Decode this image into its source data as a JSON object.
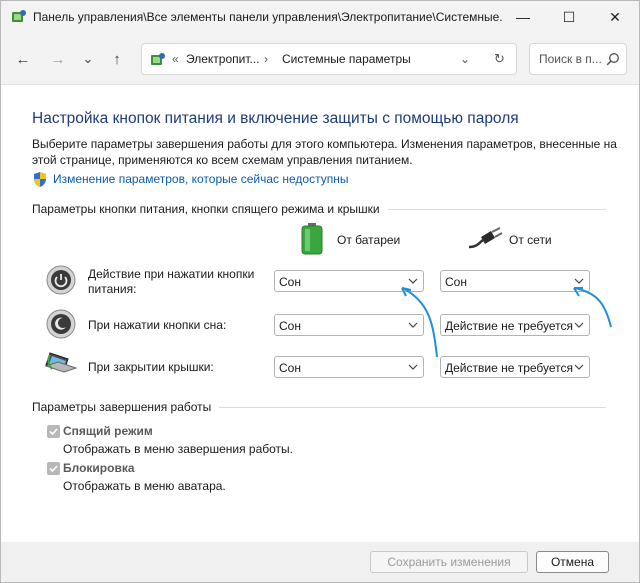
{
  "titlebar": {
    "title": "Панель управления\\Все элементы панели управления\\Электропитание\\Системные...",
    "minimize": "—",
    "maximize": "☐",
    "close": "✕"
  },
  "nav": {
    "back": "←",
    "forward": "→",
    "recent": "⌄",
    "up": "↑"
  },
  "address": {
    "overflow": "«",
    "crumb1": "Электропит...",
    "sep": "›",
    "crumb2": "Системные параметры",
    "dropdown": "⌄",
    "refresh": "↻"
  },
  "search": {
    "placeholder": "Поиск в п..."
  },
  "main": {
    "heading": "Настройка кнопок питания и включение защиты с помощью пароля",
    "description": "Выберите параметры завершения работы для этого компьютера. Изменения параметров, внесенные на этой странице, применяются ко всем схемам управления питанием.",
    "change_link": "Изменение параметров, которые сейчас недоступны"
  },
  "buttons_section": {
    "title": "Параметры кнопки питания, кнопки спящего режима и крышки",
    "col_battery": "От батареи",
    "col_ac": "От сети",
    "rows": [
      {
        "label_line1": "Действие при нажатии кнопки",
        "label_line2": "питания:",
        "battery": "Сон",
        "ac": "Сон"
      },
      {
        "label_line1": "При нажатии кнопки сна:",
        "battery": "Сон",
        "ac": "Действие не требуется"
      },
      {
        "label_line1": "При закрытии крышки:",
        "battery": "Сон",
        "ac": "Действие не требуется"
      }
    ]
  },
  "shutdown_section": {
    "title": "Параметры завершения работы",
    "items": [
      {
        "label": "Спящий режим",
        "sub": "Отображать в меню завершения работы.",
        "checked": true
      },
      {
        "label": "Блокировка",
        "sub": "Отображать в меню аватара.",
        "checked": true
      }
    ]
  },
  "footer": {
    "save": "Сохранить изменения",
    "cancel": "Отмена"
  },
  "colors": {
    "heading": "#1e3c78",
    "link": "#0b5cad",
    "annotation_arrow": "#1f8fd8"
  }
}
